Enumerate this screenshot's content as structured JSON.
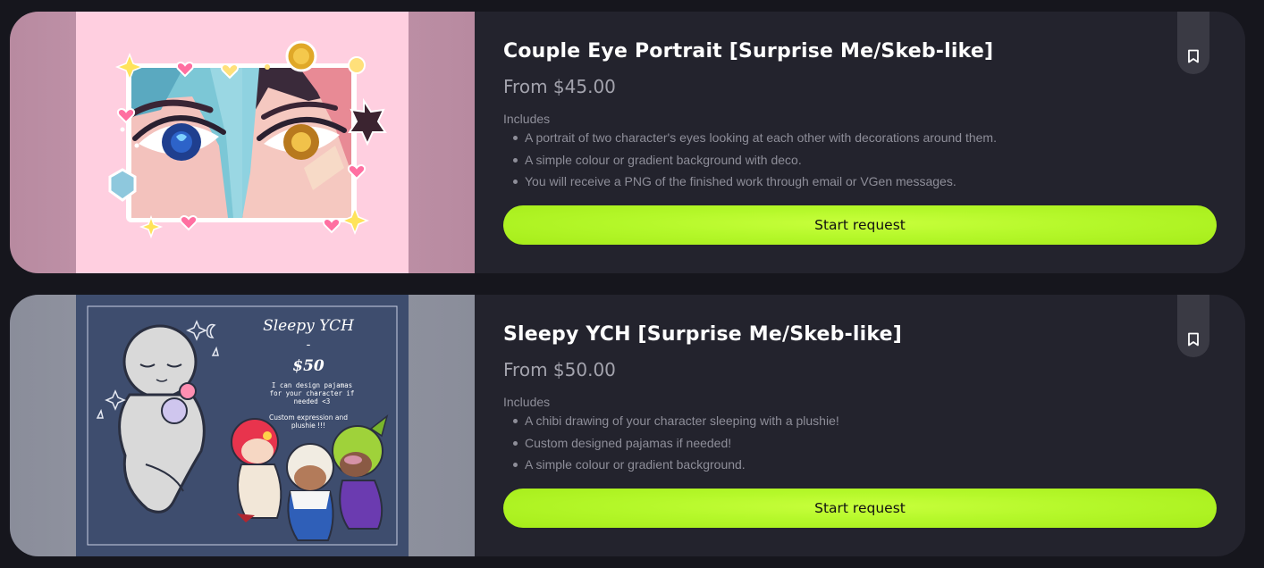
{
  "cards": [
    {
      "title": "Couple Eye Portrait [Surprise Me/Skeb-like]",
      "price": "From $45.00",
      "includes_label": "Includes",
      "includes": [
        "A portrait of two character's eyes looking at each other with decorations around them.",
        "A simple colour or gradient background with deco.",
        "You will receive a PNG of the finished work through email or VGen messages."
      ],
      "cta_label": "Start request",
      "bookmark_icon": "bookmark-icon"
    },
    {
      "title": "Sleepy YCH [Surprise Me/Skeb-like]",
      "price": "From $50.00",
      "includes_label": "Includes",
      "includes": [
        "A chibi drawing of your character sleeping with a plushie!",
        "Custom designed pajamas if needed!",
        "A simple colour or gradient background."
      ],
      "cta_label": "Start request",
      "bookmark_icon": "bookmark-icon",
      "artwork_text": {
        "heading": "Sleepy YCH",
        "dash": "-",
        "price": "$50",
        "note1_line1": "I can design pajamas",
        "note1_line2": "for your character if",
        "note1_line3": "needed <3",
        "note2_line1": "Custom expression and",
        "note2_line2": "plushie !!!"
      }
    }
  ],
  "colors": {
    "page_bg": "#16161d",
    "card_bg": "#23232d",
    "cta_accent": "#b5f82a",
    "text_primary": "#ffffff",
    "text_muted": "#8e8e99"
  }
}
